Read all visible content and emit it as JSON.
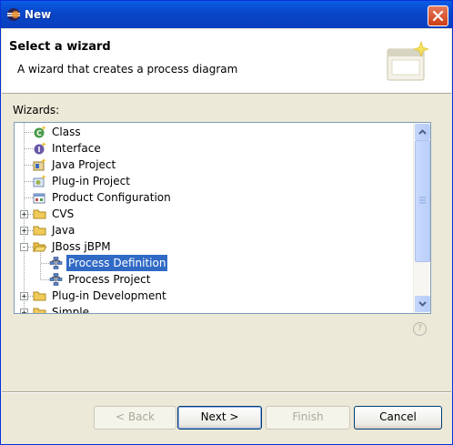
{
  "window": {
    "title": "New"
  },
  "header": {
    "title": "Select a wizard",
    "description": "A wizard that creates a process diagram"
  },
  "wizards_label": "Wizards:",
  "tree": {
    "items": [
      {
        "label": "Class",
        "icon": "java-class-icon"
      },
      {
        "label": "Interface",
        "icon": "java-interface-icon"
      },
      {
        "label": "Java Project",
        "icon": "java-project-icon"
      },
      {
        "label": "Plug-in Project",
        "icon": "plugin-project-icon"
      },
      {
        "label": "Product Configuration",
        "icon": "product-configuration-icon"
      },
      {
        "label": "CVS",
        "icon": "folder-icon",
        "expander": "+"
      },
      {
        "label": "Java",
        "icon": "folder-icon",
        "expander": "+"
      },
      {
        "label": "JBoss jBPM",
        "icon": "folder-open-icon",
        "expander": "-"
      },
      {
        "label": "Process Definition",
        "icon": "process-icon",
        "selected": true
      },
      {
        "label": "Process Project",
        "icon": "process-icon"
      },
      {
        "label": "Plug-in Development",
        "icon": "folder-icon",
        "expander": "+"
      },
      {
        "label": "Simple",
        "icon": "folder-icon",
        "expander": "+"
      }
    ]
  },
  "buttons": {
    "back": "< Back",
    "next": "Next >",
    "finish": "Finish",
    "cancel": "Cancel"
  },
  "colors": {
    "selection": "#316ac5",
    "titlebar": "#0a5de6",
    "dialog_bg": "#ece9d8"
  }
}
